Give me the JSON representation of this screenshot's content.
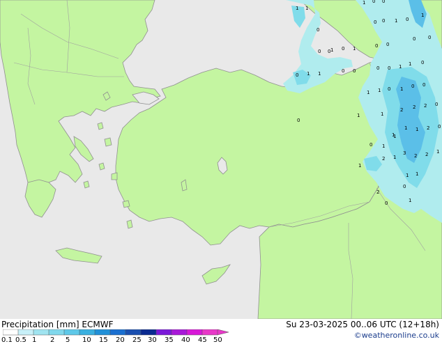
{
  "legend": {
    "title": "Precipitation [mm]",
    "model": "ECMWF",
    "valid_time": "Su 23-03-2025 00..06 UTC (12+18h)",
    "credit": "©weatheronline.co.uk",
    "scale_values": [
      "0.1",
      "0.5",
      "1",
      "2",
      "5",
      "10",
      "15",
      "20",
      "25",
      "30",
      "35",
      "40",
      "45",
      "50"
    ],
    "scale_colors": [
      "#ffffff",
      "#c8f0f8",
      "#a0e4f0",
      "#80d8ec",
      "#5ec8e8",
      "#3ab0e0",
      "#2090d8",
      "#1a6fd0",
      "#1a4fb0",
      "#0a2a90",
      "#7a18d8",
      "#a818d8",
      "#d818d8",
      "#e838c8"
    ]
  },
  "precip_labels": [
    {
      "t": "1"
    },
    {
      "t": "1"
    },
    {
      "t": "1"
    },
    {
      "t": "0"
    },
    {
      "t": "0"
    },
    {
      "t": "0"
    },
    {
      "t": "0"
    },
    {
      "t": "0"
    },
    {
      "t": "0"
    },
    {
      "t": "1"
    },
    {
      "t": "1"
    },
    {
      "t": "0"
    },
    {
      "t": "0"
    },
    {
      "t": "1"
    },
    {
      "t": "0"
    },
    {
      "t": "0"
    },
    {
      "t": "0"
    },
    {
      "t": "0"
    },
    {
      "t": "0"
    },
    {
      "t": "1"
    },
    {
      "t": "1"
    },
    {
      "t": "0"
    },
    {
      "t": "0"
    },
    {
      "t": "0"
    },
    {
      "t": "1"
    },
    {
      "t": "1"
    },
    {
      "t": "0"
    },
    {
      "t": "0"
    },
    {
      "t": "0"
    },
    {
      "t": "1"
    },
    {
      "t": "0"
    },
    {
      "t": "1"
    },
    {
      "t": "1"
    },
    {
      "t": "0"
    },
    {
      "t": "1"
    },
    {
      "t": "0"
    },
    {
      "t": "0"
    },
    {
      "t": "2"
    },
    {
      "t": "2"
    },
    {
      "t": "2"
    },
    {
      "t": "0"
    },
    {
      "t": "1"
    },
    {
      "t": "1"
    },
    {
      "t": "1"
    },
    {
      "t": "1"
    },
    {
      "t": "2"
    },
    {
      "t": "0"
    },
    {
      "t": "1"
    },
    {
      "t": "3"
    },
    {
      "t": "2"
    },
    {
      "t": "2"
    },
    {
      "t": "1"
    },
    {
      "t": "2"
    },
    {
      "t": "1"
    },
    {
      "t": "1"
    },
    {
      "t": "1"
    },
    {
      "t": "2"
    },
    {
      "t": "1"
    },
    {
      "t": "1"
    },
    {
      "t": "1"
    },
    {
      "t": "0"
    },
    {
      "t": "1"
    },
    {
      "t": "0"
    },
    {
      "t": "0"
    }
  ]
}
